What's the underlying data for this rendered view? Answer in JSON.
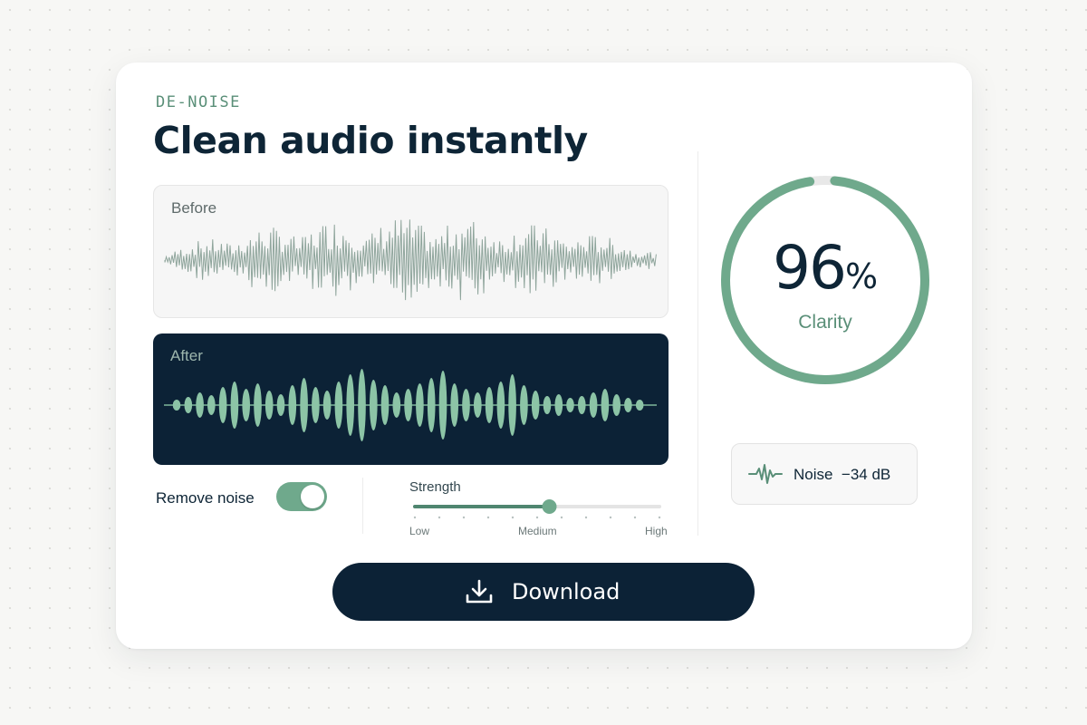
{
  "header": {
    "eyebrow": "DE-NOISE",
    "title": "Clean audio instantly"
  },
  "waveforms": {
    "before_label": "Before",
    "after_label": "After"
  },
  "controls": {
    "remove_noise_label": "Remove noise",
    "remove_noise_on": true,
    "strength_label": "Strength",
    "strength_value": 0.55,
    "strength_ticks": [
      "Low",
      "Medium",
      "High"
    ]
  },
  "clarity": {
    "value": "96",
    "unit": "%",
    "fraction": 0.96,
    "label": "Clarity"
  },
  "noise": {
    "label": "Noise",
    "value": "−34 dB"
  },
  "actions": {
    "download_label": "Download"
  },
  "colors": {
    "accent": "#6fa98c",
    "navy": "#0c2236",
    "track": "#e4e4e4"
  },
  "icons": {
    "noise": "waveform-icon",
    "download": "download-icon"
  }
}
